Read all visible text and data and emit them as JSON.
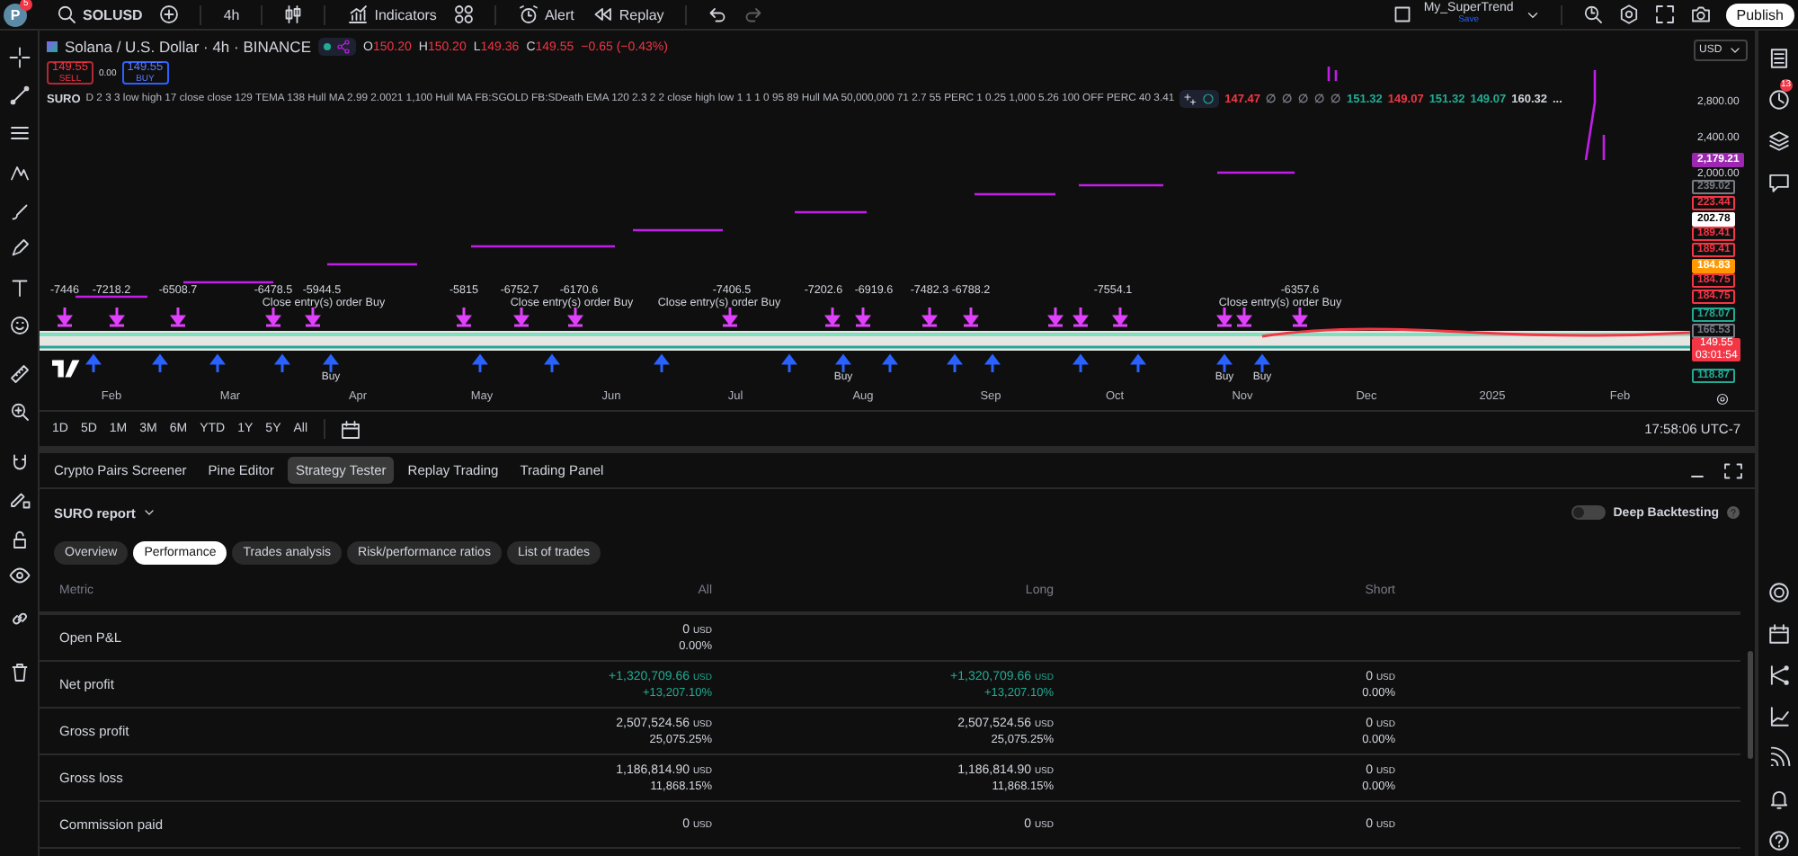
{
  "topbar": {
    "avatar": "P",
    "notifications": "5",
    "symbol": "SOLUSD",
    "interval": "4h",
    "indicators": "Indicators",
    "alert": "Alert",
    "replay": "Replay",
    "layout_name": "My_SuperTrend",
    "save_label": "Save",
    "publish": "Publish"
  },
  "chart": {
    "title": "Solana / U.S. Dollar · 4h · BINANCE",
    "falling": true,
    "ohlc": [
      {
        "key": "O",
        "value": "150.20"
      },
      {
        "key": "H",
        "value": "150.20"
      },
      {
        "key": "L",
        "value": "149.36"
      },
      {
        "key": "C",
        "value": "149.55"
      }
    ],
    "change": "−0.65 (−0.43%)",
    "sell": {
      "price": "149.55",
      "label": "SELL"
    },
    "spread": "0.00",
    "buy": {
      "price": "149.55",
      "label": "BUY"
    },
    "study_name": "SURO",
    "study_params": "D 2 3 3 low high 17 close close 129 TEMA 138 Hull MA 2.99 2.0021 1,100 Hull MA FB:SGOLD FB:SDeath EMA 120 2.3 2 2 close high low 1 1 1 0 95 89 Hull MA 50,000,000 71 2.7 55 PERC 1 0.25 1,000 5.26 100 OFF PERC 40 3.41",
    "study_values": [
      {
        "text": "147.47",
        "color": "#f23645"
      },
      {
        "text": "∅",
        "color": "#787b86"
      },
      {
        "text": "∅",
        "color": "#787b86"
      },
      {
        "text": "∅",
        "color": "#787b86"
      },
      {
        "text": "∅",
        "color": "#787b86"
      },
      {
        "text": "∅",
        "color": "#787b86"
      },
      {
        "text": "151.32",
        "color": "#22ab94"
      },
      {
        "text": "149.07",
        "color": "#f23645"
      },
      {
        "text": "151.32",
        "color": "#22ab94"
      },
      {
        "text": "149.07",
        "color": "#22ab94"
      },
      {
        "text": "160.32",
        "color": "#d1d4dc"
      },
      {
        "text": "...",
        "color": "#d1d4dc"
      }
    ],
    "currency": "USD",
    "price_labels": [
      {
        "text": "2,800.00",
        "kind": "grid"
      },
      {
        "text": "2,400.00",
        "kind": "grid"
      },
      {
        "text": "2,179.21",
        "kind": "filled",
        "color": "#9c27b0"
      },
      {
        "text": "2,000.00",
        "kind": "grid"
      },
      {
        "text": "239.02",
        "kind": "outline",
        "color": "#787b86"
      },
      {
        "text": "223.44",
        "kind": "outline",
        "color": "#f23645"
      },
      {
        "text": "202.78",
        "kind": "filled",
        "color": "#ffffff"
      },
      {
        "text": "189.41",
        "kind": "outline",
        "color": "#f23645"
      },
      {
        "text": "189.41",
        "kind": "outline",
        "color": "#f23645"
      },
      {
        "text": "184.83",
        "kind": "filled",
        "color": "#ff9800"
      },
      {
        "text": "184.75",
        "kind": "outline",
        "color": "#f23645"
      },
      {
        "text": "184.75",
        "kind": "outline",
        "color": "#f23645"
      },
      {
        "text": "178.07",
        "kind": "outline",
        "color": "#22ab94"
      },
      {
        "text": "166.53",
        "kind": "outline",
        "color": "#787b86"
      },
      {
        "text": "149.55",
        "kind": "current",
        "color": "#f23645",
        "countdown": "03:01:54"
      },
      {
        "text": "118.87",
        "kind": "outline",
        "color": "#22ab94"
      }
    ],
    "trade_values": [
      "-7446",
      "-7218.2",
      "-6508.7",
      "-6478.5",
      "-5944.5",
      "-5815",
      "-6752.7",
      "-6170.6",
      "-7406.5",
      "-7202.6",
      "-6919.6",
      "-7482.3",
      "-6788.2",
      "-7554.1",
      "-6357.6"
    ],
    "trade_notes": [
      "Close entry(s) order Buy",
      "Close entry(s) order Buy",
      "Close entry(s) order Buy",
      "Close entry(s) order Buy"
    ],
    "buy_labels": [
      "Buy",
      "Buy",
      "Buy",
      "Buy"
    ],
    "months": [
      "Feb",
      "Mar",
      "Apr",
      "May",
      "Jun",
      "Jul",
      "Aug",
      "Sep",
      "Oct",
      "Nov",
      "Dec",
      "2025",
      "Feb"
    ],
    "ranges": [
      "1D",
      "5D",
      "1M",
      "3M",
      "6M",
      "YTD",
      "1Y",
      "5Y",
      "All"
    ],
    "clock": "17:58:06 UTC-7"
  },
  "sidebar": {
    "badge": "13"
  },
  "panel": {
    "tabs": [
      {
        "label": "Crypto Pairs Screener",
        "selected": false
      },
      {
        "label": "Pine Editor",
        "selected": false
      },
      {
        "label": "Strategy Tester",
        "selected": true
      },
      {
        "label": "Replay Trading",
        "selected": false
      },
      {
        "label": "Trading Panel",
        "selected": false
      }
    ],
    "report": "SURO report",
    "deep_backtesting": {
      "label": "Deep Backtesting",
      "on": false
    },
    "subtabs": [
      {
        "label": "Overview",
        "selected": false
      },
      {
        "label": "Performance",
        "selected": true
      },
      {
        "label": "Trades analysis",
        "selected": false
      },
      {
        "label": "Risk/performance ratios",
        "selected": false
      },
      {
        "label": "List of trades",
        "selected": false
      }
    ],
    "columns": [
      "Metric",
      "All",
      "Long",
      "Short"
    ],
    "rows": [
      {
        "metric": "Open P&L",
        "all": {
          "value": "0",
          "unit": "USD",
          "percent": "0.00%",
          "positive": false
        }
      },
      {
        "metric": "Net profit",
        "all": {
          "value": "+1,320,709.66",
          "unit": "USD",
          "percent": "+13,207.10%",
          "positive": true
        },
        "long": {
          "value": "+1,320,709.66",
          "unit": "USD",
          "percent": "+13,207.10%",
          "positive": true
        },
        "short": {
          "value": "0",
          "unit": "USD",
          "percent": "0.00%",
          "positive": false
        }
      },
      {
        "metric": "Gross profit",
        "all": {
          "value": "2,507,524.56",
          "unit": "USD",
          "percent": "25,075.25%",
          "positive": false
        },
        "long": {
          "value": "2,507,524.56",
          "unit": "USD",
          "percent": "25,075.25%",
          "positive": false
        },
        "short": {
          "value": "0",
          "unit": "USD",
          "percent": "0.00%",
          "positive": false
        }
      },
      {
        "metric": "Gross loss",
        "all": {
          "value": "1,186,814.90",
          "unit": "USD",
          "percent": "11,868.15%",
          "positive": false
        },
        "long": {
          "value": "1,186,814.90",
          "unit": "USD",
          "percent": "11,868.15%",
          "positive": false
        },
        "short": {
          "value": "0",
          "unit": "USD",
          "percent": "0.00%",
          "positive": false
        }
      },
      {
        "metric": "Commission paid",
        "all": {
          "value": "0",
          "unit": "USD",
          "positive": false
        },
        "long": {
          "value": "0",
          "unit": "USD",
          "positive": false
        },
        "short": {
          "value": "0",
          "unit": "USD",
          "positive": false
        }
      }
    ]
  }
}
